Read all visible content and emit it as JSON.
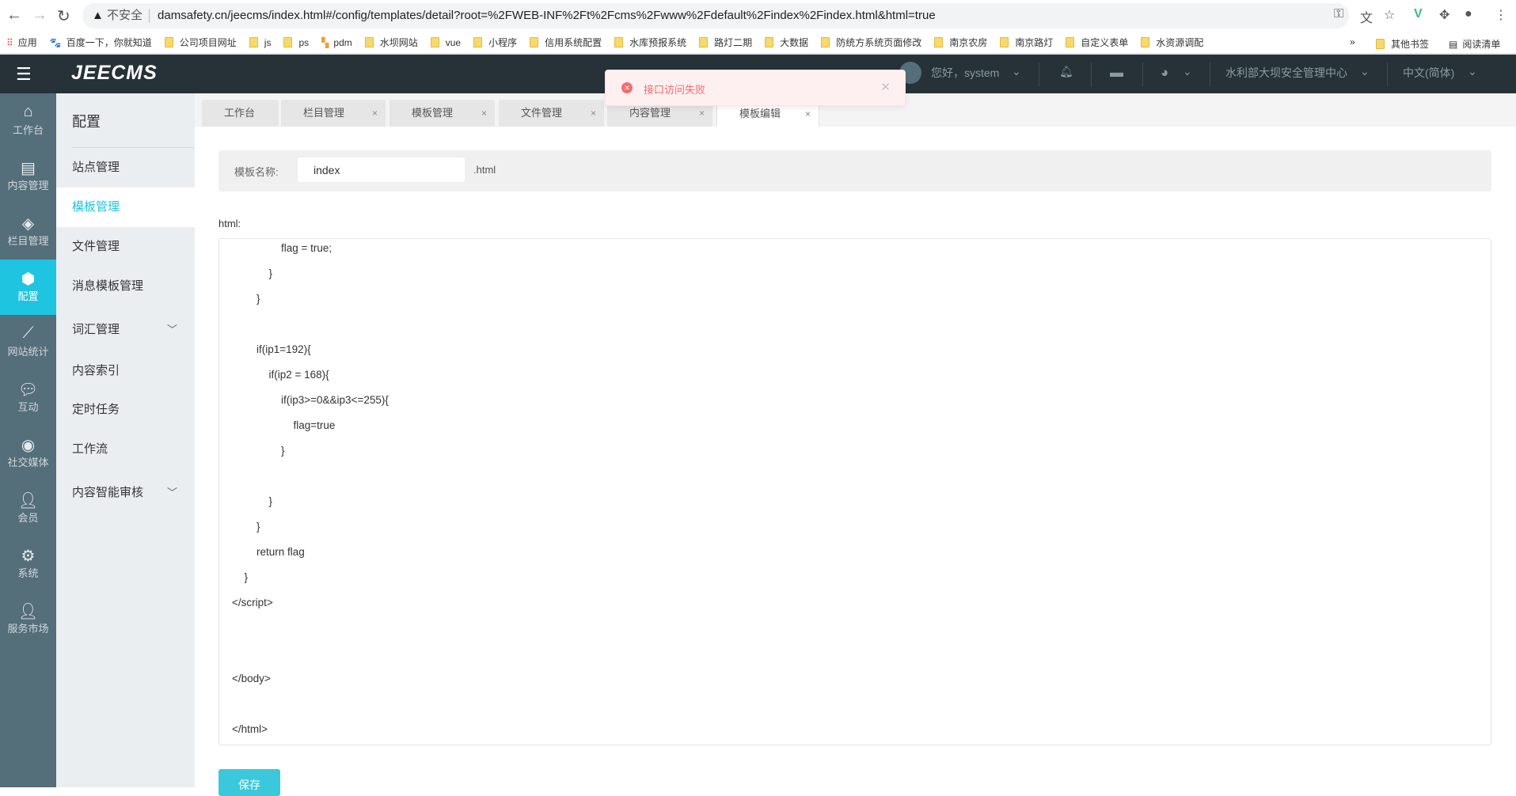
{
  "browser": {
    "insecure": "不安全",
    "url": "damsafety.cn/jeecms/index.html#/config/templates/detail?root=%2FWEB-INF%2Ft%2Fcms%2Fwww%2Fdefault%2Findex%2Findex.html&html=true",
    "bookmarks": [
      "应用",
      "百度一下，你就知道",
      "公司项目网址",
      "js",
      "ps",
      "pdm",
      "水坝网站",
      "vue",
      "小程序",
      "信用系统配置",
      "水库预报系统",
      "路灯二期",
      "大数据",
      "防统方系统页面修改",
      "南京农房",
      "南京路灯",
      "自定义表单",
      "水资源调配"
    ],
    "more": "»",
    "other_bookmarks": "其他书签",
    "reading_list": "阅读清单"
  },
  "header": {
    "logo": "JEECMS",
    "greeting": "您好，system",
    "site": "水利部大坝安全管理中心",
    "language": "中文(简体)"
  },
  "sidebar": [
    {
      "label": "工作台",
      "icon": "home-icon"
    },
    {
      "label": "内容管理",
      "icon": "document-icon"
    },
    {
      "label": "栏目管理",
      "icon": "layers-icon"
    },
    {
      "label": "配置",
      "icon": "cube-icon",
      "active": true
    },
    {
      "label": "网站统计",
      "icon": "chart-icon"
    },
    {
      "label": "互动",
      "icon": "chat-icon"
    },
    {
      "label": "社交媒体",
      "icon": "target-icon"
    },
    {
      "label": "会员",
      "icon": "user-icon"
    },
    {
      "label": "系统",
      "icon": "gear-icon"
    },
    {
      "label": "服务市场",
      "icon": "market-icon"
    }
  ],
  "submenu": {
    "title": "配置",
    "items": [
      {
        "label": "站点管理"
      },
      {
        "label": "模板管理",
        "active": true
      },
      {
        "label": "文件管理"
      },
      {
        "label": "消息模板管理"
      },
      {
        "label": "词汇管理",
        "expandable": true
      },
      {
        "label": "内容索引"
      },
      {
        "label": "定时任务"
      },
      {
        "label": "工作流"
      },
      {
        "label": "内容智能审核",
        "expandable": true
      }
    ]
  },
  "tabs": [
    {
      "label": "工作台",
      "closable": false
    },
    {
      "label": "栏目管理",
      "closable": true
    },
    {
      "label": "模板管理",
      "closable": true
    },
    {
      "label": "文件管理",
      "closable": true
    },
    {
      "label": "内容管理",
      "closable": true
    },
    {
      "label": "模板编辑",
      "closable": true,
      "active": true
    }
  ],
  "form": {
    "name_label": "模板名称:",
    "name_value": "index",
    "suffix": ".html",
    "html_label": "html:",
    "save": "保存"
  },
  "code": [
    {
      "t": "flag = true;",
      "i": 4
    },
    {
      "t": "}",
      "i": 3
    },
    {
      "t": "}",
      "i": 2
    },
    {
      "t": "",
      "i": 0
    },
    {
      "t": "if(ip1=192){",
      "i": 2
    },
    {
      "t": "if(ip2 = 168){",
      "i": 3
    },
    {
      "t": "if(ip3>=0&&ip3<=255){",
      "i": 4
    },
    {
      "t": "flag=true",
      "i": 5
    },
    {
      "t": "}",
      "i": 4
    },
    {
      "t": "",
      "i": 0
    },
    {
      "t": "}",
      "i": 3
    },
    {
      "t": "}",
      "i": 2
    },
    {
      "t": "return flag",
      "i": 2
    },
    {
      "t": "}",
      "i": 1
    },
    {
      "t": "</script>",
      "i": 0
    },
    {
      "t": "",
      "i": 0
    },
    {
      "t": "",
      "i": 0
    },
    {
      "t": "</body>",
      "i": 0
    },
    {
      "t": "",
      "i": 0
    },
    {
      "t": "</html>",
      "i": 0
    }
  ],
  "toast": {
    "message": "接口访问失败"
  },
  "colors": {
    "accent": "#1fc4e0",
    "header": "#263238",
    "sidebar": "#546e7a",
    "error": "#f56c6c"
  }
}
